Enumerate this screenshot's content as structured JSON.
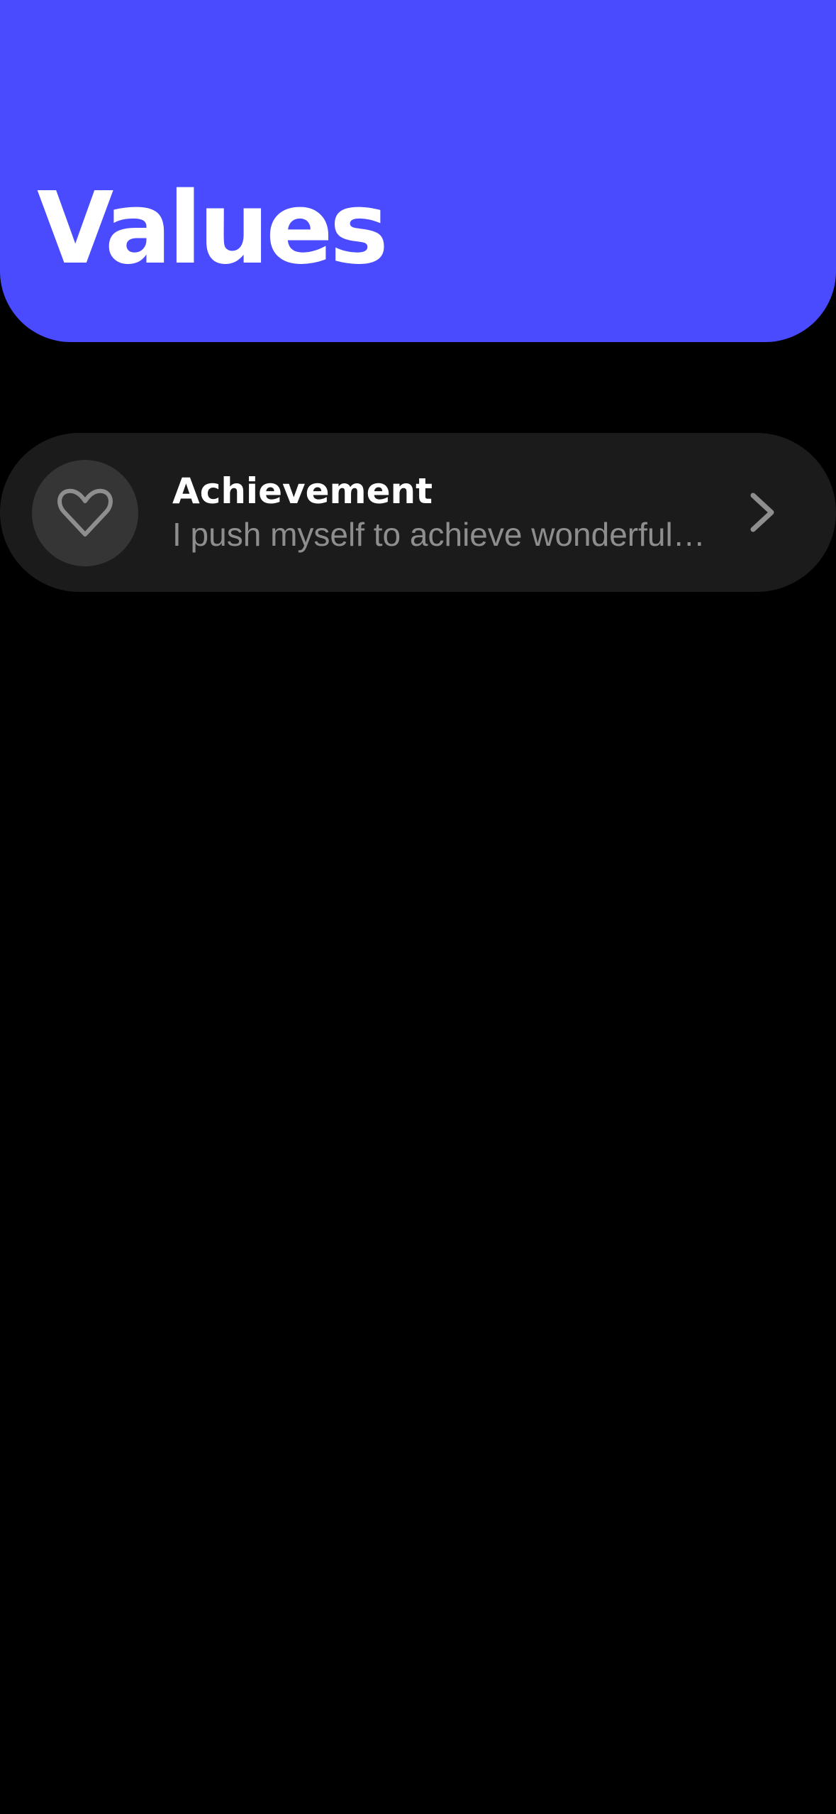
{
  "header": {
    "title": "Values",
    "background_color": "#4a4bff"
  },
  "values_list": {
    "items": [
      {
        "title": "Achievement",
        "description": "I push myself to achieve wonderful things",
        "icon": "heart-icon",
        "action_icon": "chevron-right-icon"
      }
    ]
  },
  "colors": {
    "background": "#000000",
    "row_background": "#1b1b1b",
    "icon_circle": "#353535",
    "icon_stroke": "#8e8e8e",
    "subtitle_text": "#8e8e8e"
  }
}
